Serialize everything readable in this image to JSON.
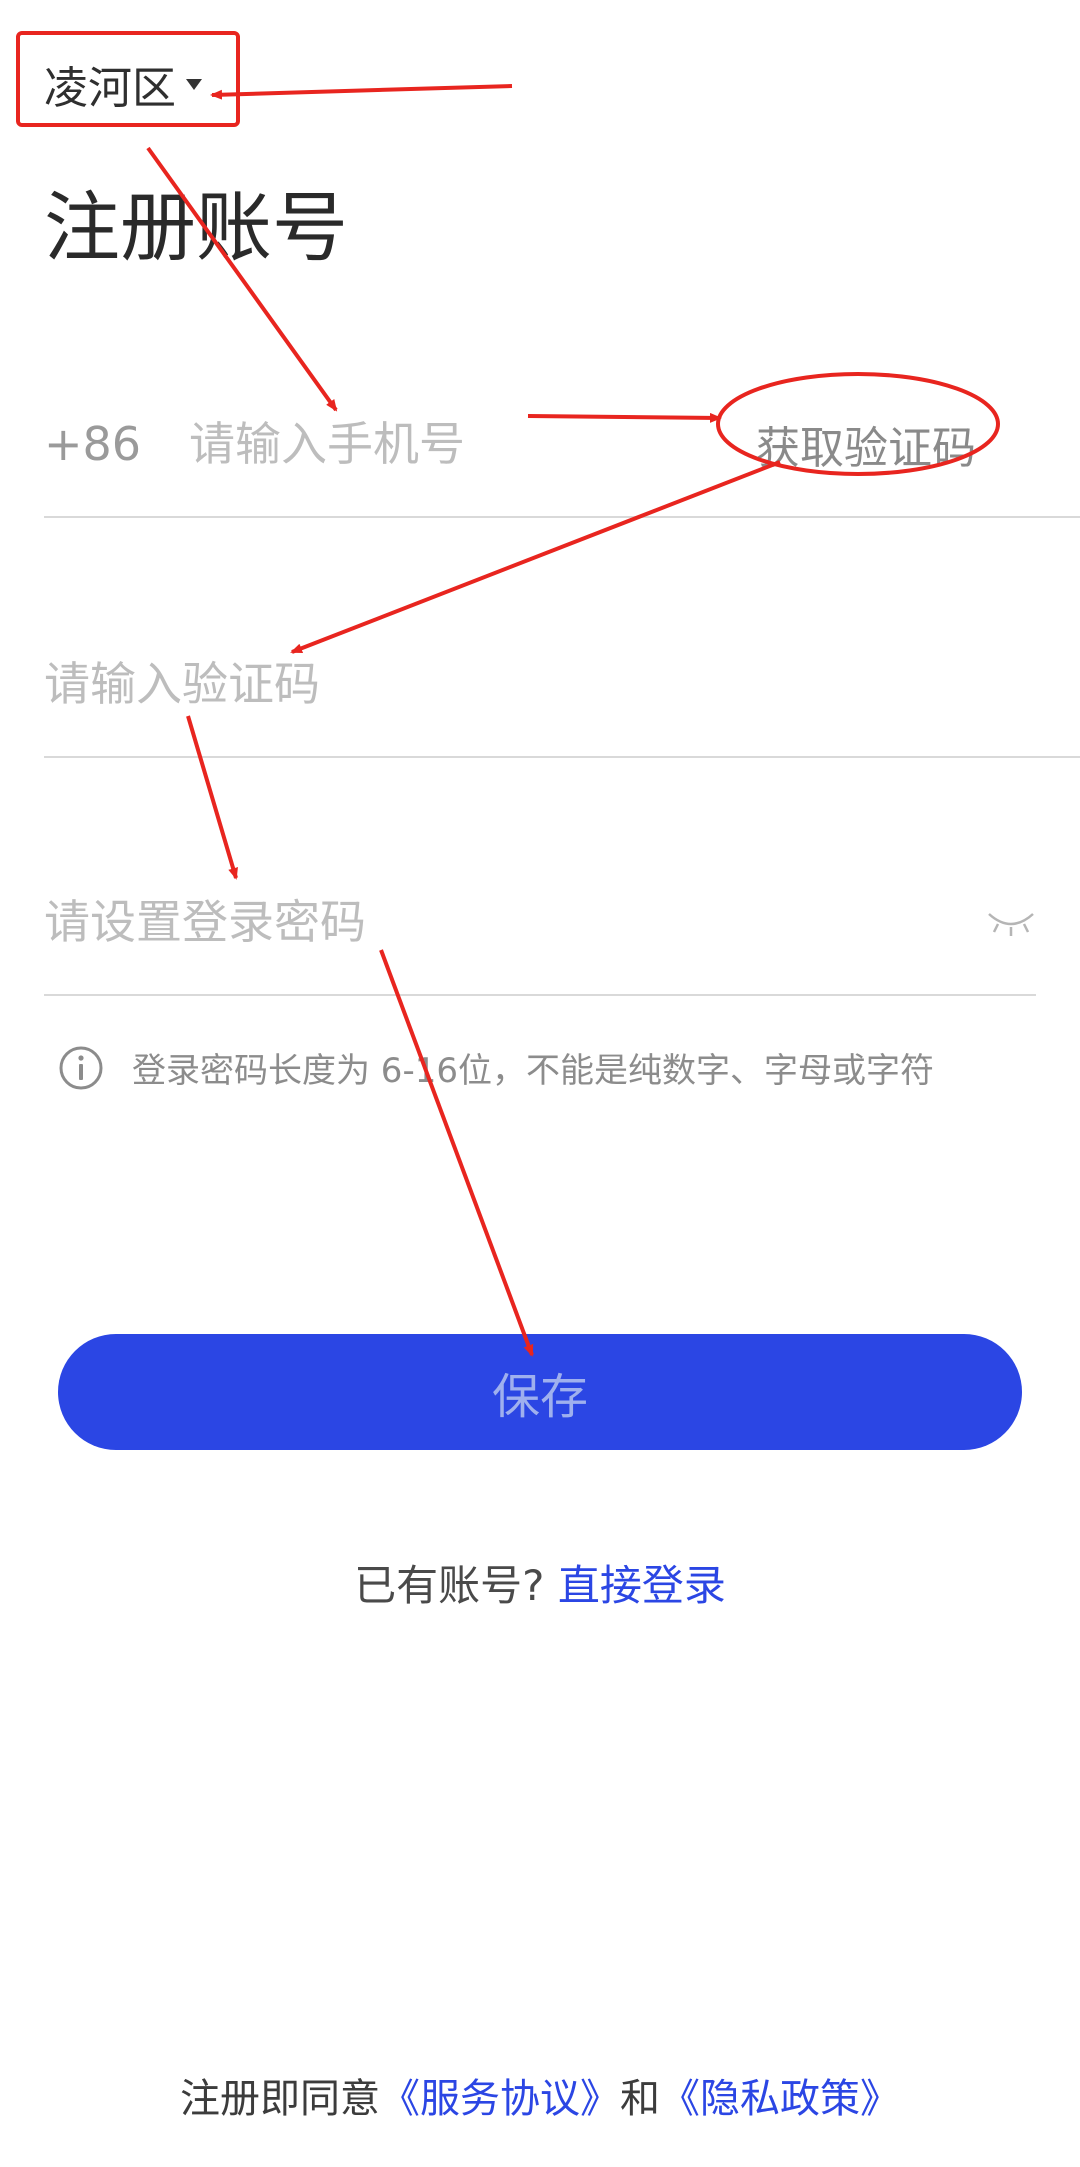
{
  "header": {
    "region": "凌河区"
  },
  "title": "注册账号",
  "phone": {
    "country_code": "+86",
    "placeholder": "请输入手机号",
    "get_code": "获取验证码"
  },
  "code": {
    "placeholder": "请输入验证码"
  },
  "password": {
    "placeholder": "请设置登录密码"
  },
  "hint": "登录密码长度为 6-16位，不能是纯数字、字母或字符",
  "save_button": "保存",
  "login": {
    "prompt": "已有账号?",
    "link": "直接登录"
  },
  "agreement": {
    "prefix": "注册即同意",
    "service": "《服务协议》",
    "and": "和",
    "privacy": "《隐私政策》"
  },
  "colors": {
    "primary": "#2b46e4",
    "annotation": "#e8251f"
  },
  "icons": {
    "region_caret": "caret-down-icon",
    "password_toggle": "eye-closed-icon",
    "hint": "info-icon"
  }
}
